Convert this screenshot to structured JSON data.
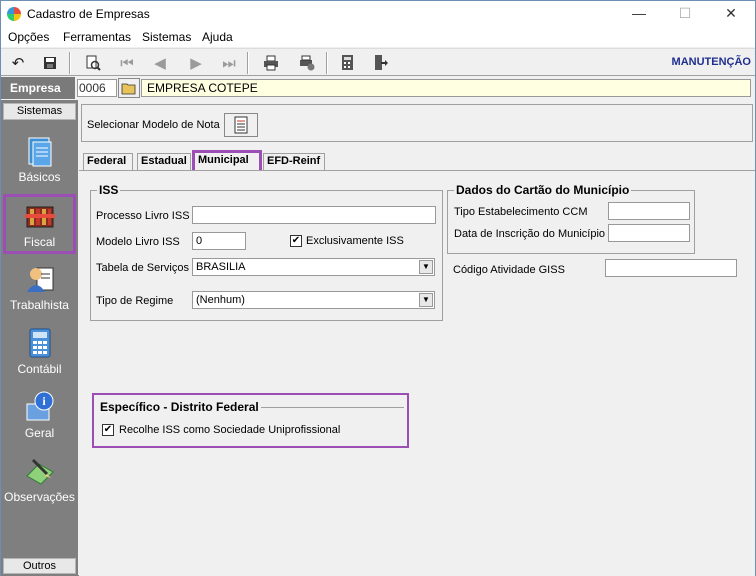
{
  "window": {
    "title": "Cadastro de Empresas",
    "minimize": "—",
    "maximize": "☐",
    "close": "✕"
  },
  "menu": {
    "opcoes": "Opções",
    "ferramentas": "Ferramentas",
    "sistemas": "Sistemas",
    "ajuda": "Ajuda"
  },
  "toolbar": {
    "mode": "MANUTENÇÃO"
  },
  "empresa": {
    "label": "Empresa",
    "code": "0006",
    "name": "EMPRESA COTEPE"
  },
  "sidebar": {
    "header": "Sistemas",
    "footer": "Outros",
    "items": [
      {
        "label": "Básicos"
      },
      {
        "label": "Fiscal"
      },
      {
        "label": "Trabalhista"
      },
      {
        "label": "Contábil"
      },
      {
        "label": "Geral"
      },
      {
        "label": "Observações"
      }
    ]
  },
  "modelo": {
    "label": "Selecionar Modelo de Nota"
  },
  "tabs": [
    "Federal",
    "Estadual",
    "Municipal",
    "EFD-Reinf"
  ],
  "iss": {
    "title": "ISS",
    "processo_label": "Processo Livro ISS",
    "processo_value": "",
    "modelo_label": "Modelo Livro ISS",
    "modelo_value": "0",
    "exclusivamente_label": "Exclusivamente ISS",
    "exclusivamente_checked": "✔",
    "tabela_label": "Tabela de Serviços",
    "tabela_value": "BRASILIA",
    "regime_label": "Tipo de Regime",
    "regime_value": "(Nenhum)"
  },
  "cartao": {
    "title": "Dados do Cartão do Município",
    "ccm_label": "Tipo Estabelecimento CCM",
    "ccm_value": "",
    "data_label": "Data de Inscrição do Município",
    "data_value": ""
  },
  "giss": {
    "label": "Código Atividade GISS",
    "value": ""
  },
  "especifico": {
    "title": "Específico  - Distrito Federal",
    "recolhe_label": "Recolhe ISS como Sociedade Uniprofissional",
    "recolhe_checked": "✔"
  }
}
